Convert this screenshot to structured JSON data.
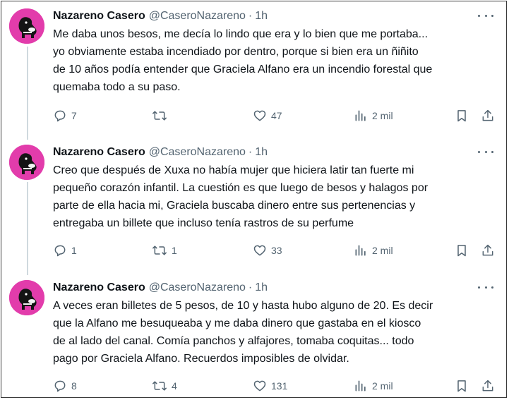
{
  "tweets": [
    {
      "author": "Nazareno Casero",
      "handle": "@CaseroNazareno",
      "separator": "·",
      "time": "1h",
      "lines": [
        "Me daba unos besos, me decía lo lindo que era y lo bien que me portaba...",
        "yo obviamente estaba incendiado por dentro, porque si bien era un ñiñito",
        "de 10 años podía entender que Graciela Alfano era un incendio forestal que",
        "quemaba todo a su paso."
      ],
      "replies": "7",
      "retweets": "",
      "likes": "47",
      "views": "2 mil"
    },
    {
      "author": "Nazareno Casero",
      "handle": "@CaseroNazareno",
      "separator": "·",
      "time": "1h",
      "lines": [
        "Creo que después de Xuxa no había mujer que hiciera latir tan fuerte mi",
        "pequeño corazón infantil. La cuestión es que luego de besos y halagos por",
        "parte de ella hacia mi, Graciela buscaba dinero entre sus pertenencias y",
        "entregaba un billete que incluso tenía rastros de su perfume"
      ],
      "replies": "1",
      "retweets": "1",
      "likes": "33",
      "views": "2 mil"
    },
    {
      "author": "Nazareno Casero",
      "handle": "@CaseroNazareno",
      "separator": "·",
      "time": "1h",
      "lines": [
        "A veces eran billetes de 5 pesos, de 10 y hasta hubo alguno de 20. Es decir",
        "que la Alfano me besuqueaba y me daba dinero que gastaba en el kiosco",
        "de al lado del canal. Comía panchos y alfajores, tomaba coquitas... todo",
        "pago por Graciela Alfano. Recuerdos imposibles de olvidar."
      ],
      "replies": "8",
      "retweets": "4",
      "likes": "131",
      "views": "2 mil"
    }
  ],
  "icons": {
    "reply": "reply-icon",
    "retweet": "retweet-icon",
    "like": "heart-icon",
    "views": "views-chart-icon",
    "bookmark": "bookmark-icon",
    "share": "share-icon",
    "more": "more-icon",
    "avatar": "dog-avatar"
  },
  "colors": {
    "avatar_bg": "#e23cab",
    "muted": "#536471",
    "text": "#0f1419",
    "thread_line": "#cfd9de"
  }
}
